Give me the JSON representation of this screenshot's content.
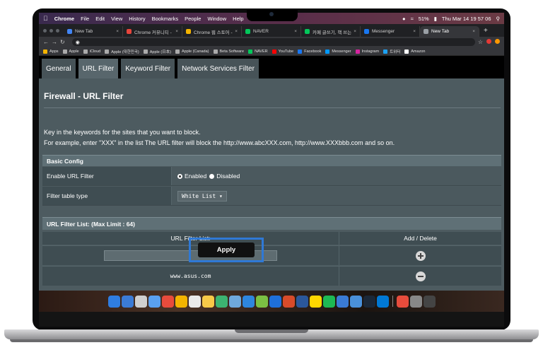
{
  "menubar": {
    "app": "Chrome",
    "items": [
      "File",
      "Edit",
      "View",
      "History",
      "Bookmarks",
      "People",
      "Window",
      "Help"
    ],
    "battery": "51%",
    "datetime": "Thu Mar 14  19 57 06"
  },
  "tabs": [
    {
      "label": "New Tab",
      "color": "#4285f4"
    },
    {
      "label": "Chrome 커뮤니티 - 'H",
      "color": "#e8453c"
    },
    {
      "label": "Chrome 웹 스토어 - In",
      "color": "#f4b400"
    },
    {
      "label": "NAVER",
      "color": "#03c75a"
    },
    {
      "label": "카페 글쓰기, 책 쓰는 사람",
      "color": "#03c75a"
    },
    {
      "label": "Messenger",
      "color": "#1877f2"
    },
    {
      "label": "New Tab",
      "color": "#9aa0a6"
    }
  ],
  "bookmarks": [
    {
      "label": "Apps",
      "color": "#f4b400"
    },
    {
      "label": "Apple",
      "color": "#aaaaaa"
    },
    {
      "label": "iCloud",
      "color": "#aaaaaa"
    },
    {
      "label": "Apple (대한민국)",
      "color": "#aaaaaa"
    },
    {
      "label": "Apple (日本)",
      "color": "#aaaaaa"
    },
    {
      "label": "Apple (Canada)",
      "color": "#aaaaaa"
    },
    {
      "label": "Beta Software",
      "color": "#aaaaaa"
    },
    {
      "label": "NAVER",
      "color": "#03c75a"
    },
    {
      "label": "YouTube",
      "color": "#ff0000"
    },
    {
      "label": "Facebook",
      "color": "#1877f2"
    },
    {
      "label": "Messenger",
      "color": "#0099ff"
    },
    {
      "label": "Instagram",
      "color": "#d6249f"
    },
    {
      "label": "트위터",
      "color": "#1da1f2"
    },
    {
      "label": "Amazon",
      "color": "#ffffff"
    }
  ],
  "router": {
    "tabs": [
      "General",
      "URL Filter",
      "Keyword Filter",
      "Network Services Filter"
    ],
    "title": "Firewall - URL Filter",
    "desc1": "Key in the keywords for the sites that you want to block.",
    "desc2": "For example, enter \"XXX\" in the list The URL filter will block the http://www.abcXXX.com, http://www.XXXbbb.com and so on.",
    "basic_config": "Basic Config",
    "enable_label": "Enable URL Filter",
    "enabled_opt": "Enabled",
    "disabled_opt": "Disabled",
    "filter_type_label": "Filter table type",
    "filter_type_value": "White List",
    "list_header": "URL Filter List: (Max Limit : 64)",
    "col_url": "URL Filter List:",
    "col_action": "Add / Delete",
    "entries": [
      "www.asus.com"
    ],
    "apply": "Apply"
  },
  "dock_colors": [
    "#2f7de1",
    "#3b7bd6",
    "#cfcfcf",
    "#5aa0f0",
    "#e94b3c",
    "#f4b400",
    "#eaeaea",
    "#f7c948",
    "#3cb371",
    "#6fa8dc",
    "#2e86de",
    "#7bc043",
    "#1e6fd9",
    "#d84b2a",
    "#2b579a",
    "#ffd700",
    "#1db954",
    "#3a7bd5",
    "#4a90d9",
    "#1b2838",
    "#0078d4",
    "#e74c3c",
    "#888888",
    "#444444"
  ],
  "accent": "#2f79d6"
}
